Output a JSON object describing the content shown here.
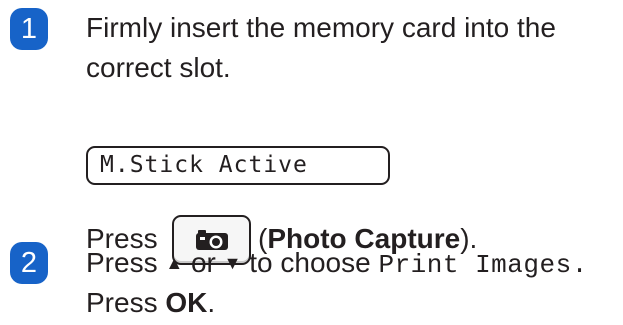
{
  "steps": [
    {
      "number": "1",
      "text_line1": "Firmly insert the memory card into the",
      "text_line2": "correct slot.",
      "lcd_display": "M.Stick Active",
      "press_prefix": "Press",
      "button_icon": "camera-icon",
      "press_paren_open": "(",
      "press_button_name": "Photo Capture",
      "press_paren_close": ")."
    },
    {
      "number": "2",
      "press_word": "Press",
      "up_arrow": "▲",
      "or_word": "or",
      "down_arrow": "▼",
      "to_choose": "to choose",
      "menu_item": "Print Images.",
      "line2_prefix": "Press",
      "ok_key": "OK",
      "line2_suffix": "."
    }
  ],
  "colors": {
    "badge": "#1763c8",
    "text": "#231f20"
  }
}
